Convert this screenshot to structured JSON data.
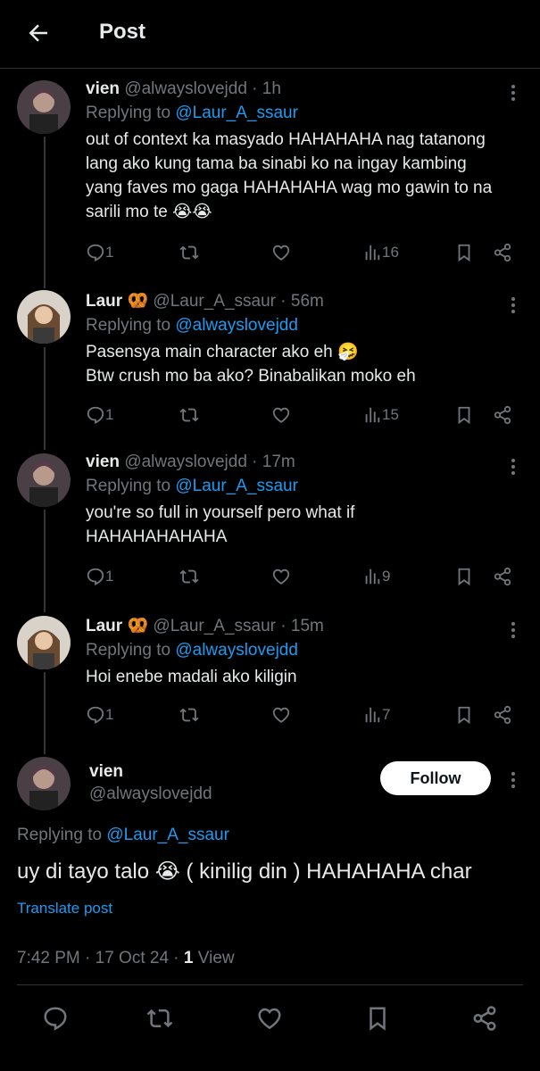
{
  "header": {
    "title": "Post"
  },
  "thread": [
    {
      "name": "vien",
      "emoji": "",
      "handle": "@alwayslovejdd",
      "time": "· 1h",
      "replying_label": "Replying to ",
      "replying_handle": "@Laur_A_ssaur",
      "lines": [
        "out of context ka masyado HAHAHAHA nag tatanong",
        "lang ako kung tama ba sinabi ko na ingay kambing",
        "yang faves mo gaga HAHAHAHA wag mo gawin to na",
        "sarili mo te 😭😭"
      ],
      "replies": "1",
      "views": "16",
      "avatar": "vien"
    },
    {
      "name": "Laur",
      "emoji": "🥨",
      "handle": "@Laur_A_ssaur",
      "time": "· 56m",
      "replying_label": "Replying to ",
      "replying_handle": "@alwayslovejdd",
      "lines": [
        "Pasensya main character ako eh 🤧",
        "Btw crush mo ba ako? Binabalikan moko eh"
      ],
      "replies": "1",
      "views": "15",
      "avatar": "laur"
    },
    {
      "name": "vien",
      "emoji": "",
      "handle": "@alwayslovejdd",
      "time": "· 17m",
      "replying_label": "Replying to ",
      "replying_handle": "@Laur_A_ssaur",
      "lines": [
        "you're so full in yourself pero what if",
        "HAHAHAHAHAHA"
      ],
      "replies": "1",
      "views": "9",
      "avatar": "vien"
    },
    {
      "name": "Laur",
      "emoji": "🥨",
      "handle": "@Laur_A_ssaur",
      "time": "· 15m",
      "replying_label": "Replying to ",
      "replying_handle": "@alwayslovejdd",
      "lines": [
        "Hoi enebe madali ako kiligin"
      ],
      "replies": "1",
      "views": "7",
      "avatar": "laur"
    }
  ],
  "main": {
    "name": "vien",
    "handle": "@alwayslovejdd",
    "follow_label": "Follow",
    "replying_label": "Replying to ",
    "replying_handle": "@Laur_A_ssaur",
    "text": "uy di tayo talo 😭 ( kinilig din ) HAHAHAHA char",
    "translate": "Translate post",
    "timestamp": "7:42 PM · 17 Oct 24 · ",
    "views_count": "1",
    "views_label": " View"
  },
  "icons": [
    "back-arrow-icon",
    "more-icon",
    "reply-icon",
    "retweet-icon",
    "like-icon",
    "views-icon",
    "bookmark-icon",
    "share-icon"
  ],
  "colors": {
    "background": "#000000",
    "text": "#e7e9ea",
    "muted": "#71767b",
    "link": "#1d9bf0",
    "divider": "#2f3336"
  }
}
